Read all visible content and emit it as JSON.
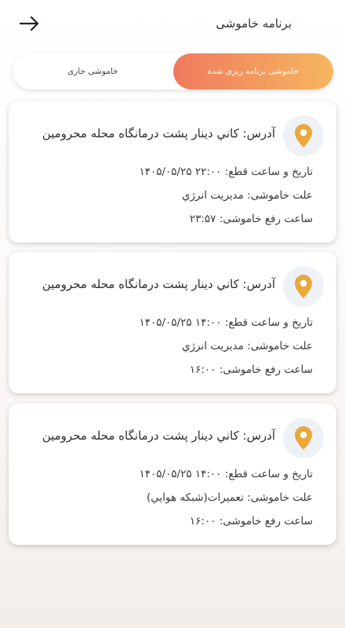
{
  "header": {
    "title": "برنامه خاموشی",
    "back_icon": "arrow-right-icon"
  },
  "tabs": [
    {
      "label": "خاموشی برنامه ریزی شده",
      "active": true
    },
    {
      "label": "خاموشی جاری",
      "active": false
    }
  ],
  "colors": {
    "accent_start": "#f07a5e",
    "accent_end": "#f6b65f",
    "pin": "#e9a83a",
    "pin_bg": "#eef1f6"
  },
  "outages": [
    {
      "address": "آدرس: کاني دينار پشت درمانگاه محله محرومين",
      "start_label": "تاریخ و ساعت قطع:",
      "start_value": "۱۴۰۵/۰۵/۲۵ ۲۲:۰۰",
      "reason_label": "علت خاموشی:",
      "reason_value": "مديريت انرژي",
      "end_label": "ساعت رفع خاموشی:",
      "end_value": "۲۳:۵۷"
    },
    {
      "address": "آدرس: کاني دينار پشت درمانگاه محله محرومين",
      "start_label": "تاریخ و ساعت قطع:",
      "start_value": "۱۴۰۵/۰۵/۲۵ ۱۴:۰۰",
      "reason_label": "علت خاموشی:",
      "reason_value": "مديريت انرژي",
      "end_label": "ساعت رفع خاموشی:",
      "end_value": "۱۶:۰۰"
    },
    {
      "address": "آدرس: کاني دينار پشت درمانگاه محله محرومين",
      "start_label": "تاریخ و ساعت قطع:",
      "start_value": "۱۴۰۵/۰۵/۲۵ ۱۴:۰۰",
      "reason_label": "علت خاموشی:",
      "reason_value": "تعميرات(شبكه هوايي)",
      "end_label": "ساعت رفع خاموشی:",
      "end_value": "۱۶:۰۰"
    }
  ]
}
